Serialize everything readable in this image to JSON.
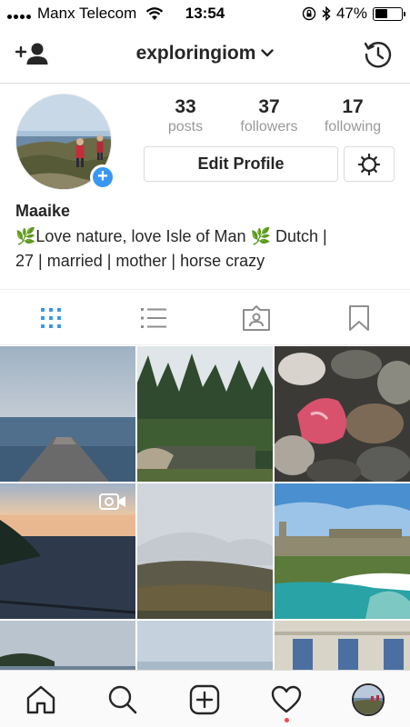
{
  "status_bar": {
    "carrier": "Manx Telecom",
    "time": "13:54",
    "battery_percent": "47%",
    "battery_level": 0.47,
    "icons": [
      "signal-icon",
      "wifi-icon",
      "orientation-lock-icon",
      "bluetooth-icon",
      "battery-icon"
    ]
  },
  "header": {
    "username": "exploringiom",
    "icons": [
      "add-user-icon",
      "chevron-down-icon",
      "archive-history-icon"
    ]
  },
  "profile": {
    "stats": [
      {
        "value": "33",
        "label": "posts"
      },
      {
        "value": "37",
        "label": "followers"
      },
      {
        "value": "17",
        "label": "following"
      }
    ],
    "edit_button_label": "Edit Profile",
    "name": "Maaike",
    "bio_line1": "🌿Love nature, love Isle of Man 🌿 Dutch |",
    "bio_line2": "27 | married | mother | horse crazy"
  },
  "view_tabs": [
    "grid-icon",
    "list-icon",
    "tagged-icon",
    "saved-icon"
  ],
  "grid": {
    "columns": 3,
    "tile_count": 9,
    "tiles": [
      {
        "subject": "harbour pier at dusk"
      },
      {
        "subject": "forest pond"
      },
      {
        "subject": "pebbles with pink rock"
      },
      {
        "subject": "coast sunset",
        "badge": "video-icon"
      },
      {
        "subject": "misty hills"
      },
      {
        "subject": "castle by the sea"
      },
      {
        "subject": "headland"
      },
      {
        "subject": "pale sky"
      },
      {
        "subject": "stone building"
      }
    ]
  },
  "bottom_nav": [
    "home-icon",
    "search-icon",
    "new-post-icon",
    "activity-heart-icon",
    "profile-avatar"
  ],
  "colors": {
    "accent": "#3897f0",
    "notification": "#ed4956",
    "border": "#dbdbdb",
    "secondary_text": "#999999"
  }
}
